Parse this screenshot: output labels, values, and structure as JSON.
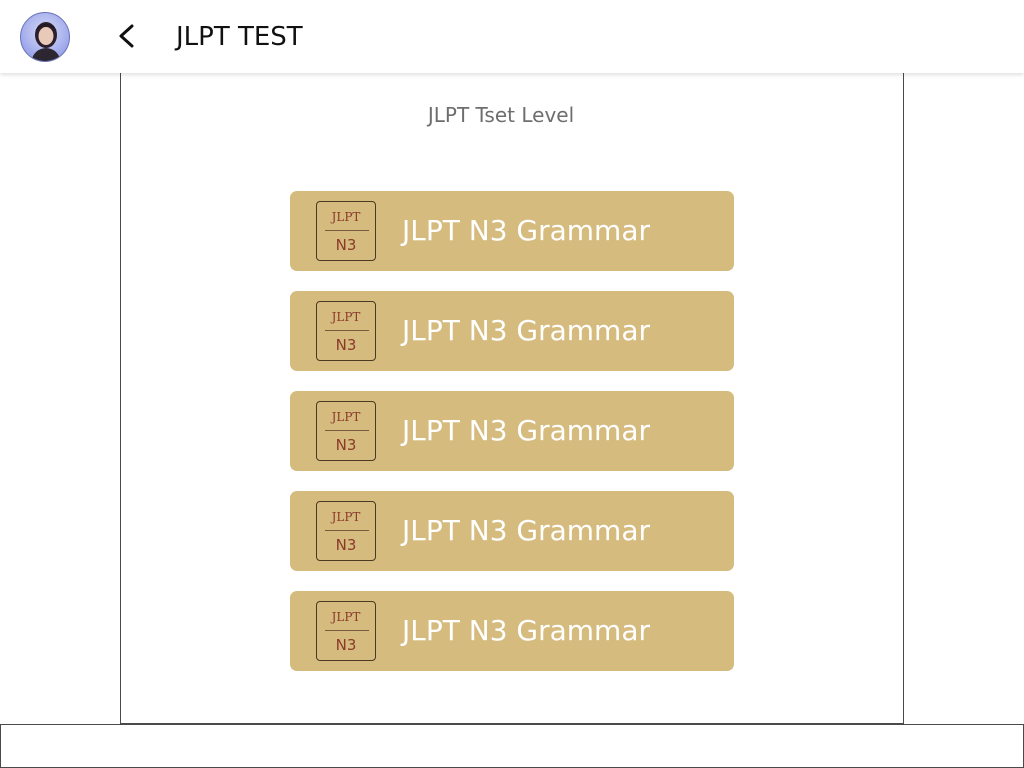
{
  "header": {
    "title": "JLPT TEST",
    "avatar_icon": "user-avatar",
    "back_icon": "chevron-left-icon"
  },
  "main": {
    "section_title": "JLPT Tset Level",
    "items": [
      {
        "label": "JLPT N3 Grammar",
        "badge_top": "JLPT",
        "badge_bottom": "N3"
      },
      {
        "label": "JLPT N3 Grammar",
        "badge_top": "JLPT",
        "badge_bottom": "N3"
      },
      {
        "label": "JLPT N3 Grammar",
        "badge_top": "JLPT",
        "badge_bottom": "N3"
      },
      {
        "label": "JLPT N3 Grammar",
        "badge_top": "JLPT",
        "badge_bottom": "N3"
      },
      {
        "label": "JLPT N3 Grammar",
        "badge_top": "JLPT",
        "badge_bottom": "N3"
      }
    ]
  },
  "colors": {
    "item_background": "#d6bb7e",
    "item_text": "#ffffff",
    "badge_text": "#8a3a2a"
  }
}
